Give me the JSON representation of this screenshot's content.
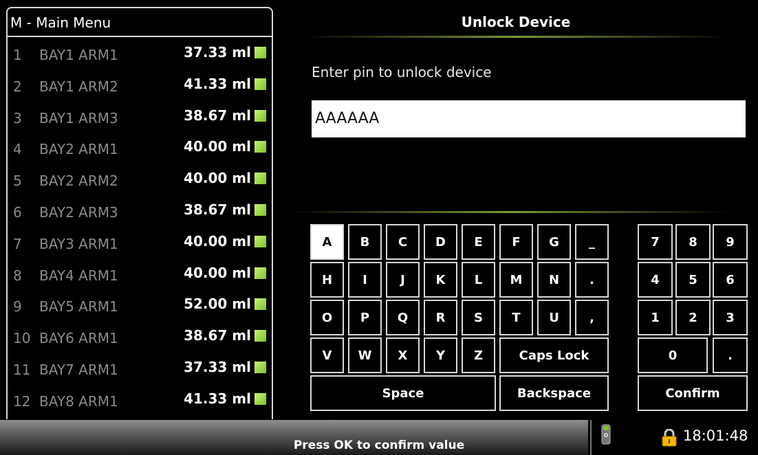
{
  "menu": {
    "title": "M - Main Menu"
  },
  "list": [
    {
      "num": "1",
      "name": "BAY1 ARM1",
      "value": "37.33 ml"
    },
    {
      "num": "2",
      "name": "BAY1 ARM2",
      "value": "41.33 ml"
    },
    {
      "num": "3",
      "name": "BAY1 ARM3",
      "value": "38.67 ml"
    },
    {
      "num": "4",
      "name": "BAY2 ARM1",
      "value": "40.00 ml"
    },
    {
      "num": "5",
      "name": "BAY2 ARM2",
      "value": "40.00 ml"
    },
    {
      "num": "6",
      "name": "BAY2 ARM3",
      "value": "38.67 ml"
    },
    {
      "num": "7",
      "name": "BAY3 ARM1",
      "value": "40.00 ml"
    },
    {
      "num": "8",
      "name": "BAY4 ARM1",
      "value": "40.00 ml"
    },
    {
      "num": "9",
      "name": "BAY5 ARM1",
      "value": "52.00 ml"
    },
    {
      "num": "10",
      "name": "BAY6 ARM1",
      "value": "38.67 ml"
    },
    {
      "num": "11",
      "name": "BAY7 ARM1",
      "value": "37.33 ml"
    },
    {
      "num": "12",
      "name": "BAY8 ARM1",
      "value": "41.33 ml"
    }
  ],
  "unlock": {
    "title": "Unlock Device",
    "prompt": "Enter pin to unlock device",
    "pin_value": "AAAAAA"
  },
  "keyboard": {
    "selected": "A",
    "letter_rows": [
      [
        "A",
        "B",
        "C",
        "D",
        "E",
        "F",
        "G",
        "_"
      ],
      [
        "H",
        "I",
        "J",
        "K",
        "L",
        "M",
        "N",
        "."
      ],
      [
        "O",
        "P",
        "Q",
        "R",
        "S",
        "T",
        "U",
        ","
      ],
      [
        "V",
        "W",
        "X",
        "Y",
        "Z"
      ]
    ],
    "caps_lock": "Caps Lock",
    "space": "Space",
    "backspace": "Backspace",
    "num_rows": [
      [
        "7",
        "8",
        "9"
      ],
      [
        "4",
        "5",
        "6"
      ],
      [
        "1",
        "2",
        "3"
      ]
    ],
    "zero": "0",
    "dot": ".",
    "confirm": "Confirm"
  },
  "status": {
    "message": "Press OK to confirm value",
    "time": "18:01:48"
  },
  "colors": {
    "indicator": "#8fd13a",
    "lock": "#f2b705"
  }
}
